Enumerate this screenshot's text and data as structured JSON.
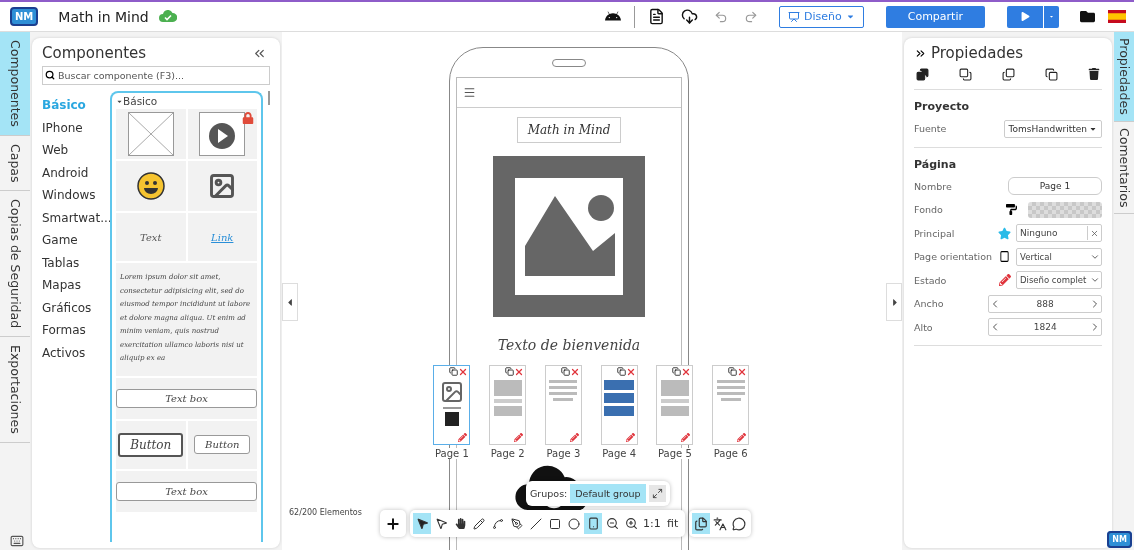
{
  "header": {
    "logo": "NM",
    "title": "Math in Mind",
    "design_button": "Diseño",
    "share_button": "Compartir"
  },
  "left_tabs": [
    {
      "label": "Componentes",
      "selected": true
    },
    {
      "label": "Capas",
      "selected": false
    },
    {
      "label": "Copias de Seguridad",
      "selected": false
    },
    {
      "label": "Exportaciones",
      "selected": false
    }
  ],
  "components_panel": {
    "title": "Componentes",
    "search": {
      "placeholder": "Buscar componente (F3)..."
    },
    "categories": [
      {
        "label": "Básico",
        "selected": true
      },
      {
        "label": "IPhone",
        "selected": false
      },
      {
        "label": "Web",
        "selected": false
      },
      {
        "label": "Android",
        "selected": false
      },
      {
        "label": "Windows",
        "selected": false
      },
      {
        "label": "Smartwat...",
        "selected": false
      },
      {
        "label": "Game",
        "selected": false
      },
      {
        "label": "Tablas",
        "selected": false
      },
      {
        "label": "Mapas",
        "selected": false
      },
      {
        "label": "Gráficos",
        "selected": false
      },
      {
        "label": "Formas",
        "selected": false
      },
      {
        "label": "Activos",
        "selected": false
      }
    ],
    "group_title": "Básico",
    "text_sample": "Text",
    "link_sample": "Link",
    "lorem": "Lorem ipsum dolor sit amet, consectetur adipisicing elit, sed do eiusmod tempor incididunt ut labore et dolore magna aliqua. Ut enim ad minim veniam, quis nostrud exercitation ullamco laboris nisi ut aliquip ex ea",
    "text_box": "Text box",
    "button_bold": "Button",
    "button_light": "Button",
    "text_box_2": "Text box"
  },
  "canvas": {
    "app_title": "Math in Mind",
    "welcome_text": "Texto de bienvenida",
    "pages": [
      {
        "label": "Page 1",
        "selected": true
      },
      {
        "label": "Page 2",
        "selected": false
      },
      {
        "label": "Page 3",
        "selected": false
      },
      {
        "label": "Page 4",
        "selected": false
      },
      {
        "label": "Page 5",
        "selected": false
      },
      {
        "label": "Page 6",
        "selected": false
      }
    ],
    "groups": {
      "label": "Grupos:",
      "value": "Default group"
    },
    "element_count": "62/200 Elementos"
  },
  "toolbar": {
    "tools": [
      {
        "kind": "select",
        "selected": true
      },
      {
        "kind": "direct-select",
        "selected": false
      },
      {
        "kind": "hand",
        "selected": false
      },
      {
        "kind": "pencil",
        "selected": false
      },
      {
        "kind": "curve",
        "selected": false
      },
      {
        "kind": "pen",
        "selected": false
      },
      {
        "kind": "line",
        "selected": false
      },
      {
        "kind": "rectangle",
        "selected": false
      },
      {
        "kind": "circle",
        "selected": false
      },
      {
        "kind": "phone",
        "selected": true
      },
      {
        "kind": "zoom-out",
        "selected": false
      },
      {
        "kind": "zoom-in",
        "selected": false
      }
    ],
    "zoom_reset": "1:1",
    "zoom_fit": "fit",
    "views": [
      {
        "kind": "pages",
        "selected": true
      },
      {
        "kind": "translate",
        "selected": false
      },
      {
        "kind": "comments",
        "selected": false
      }
    ]
  },
  "properties": {
    "title": "Propiedades",
    "project_heading": "Proyecto",
    "project_rows": [
      {
        "kind": "font",
        "label": "Fuente",
        "value": "TomsHandwritten"
      }
    ],
    "page_heading": "Página",
    "page_rows": [
      {
        "kind": "name",
        "label": "Nombre",
        "value": "Page 1"
      },
      {
        "kind": "background",
        "label": "Fondo"
      },
      {
        "kind": "master",
        "label": "Principal",
        "value": "Ninguno"
      },
      {
        "kind": "orientation",
        "label": "Page orientation",
        "value": "Vertical"
      },
      {
        "kind": "status",
        "label": "Estado",
        "value": "Diseño complet"
      },
      {
        "kind": "stepper",
        "label": "Ancho",
        "value": "888"
      },
      {
        "kind": "stepper",
        "label": "Alto",
        "value": "1824"
      }
    ]
  },
  "corner_logo": "NM",
  "right_tabs": [
    {
      "label": "Propiedades",
      "selected": true
    },
    {
      "label": "Comentarios",
      "selected": false
    }
  ]
}
